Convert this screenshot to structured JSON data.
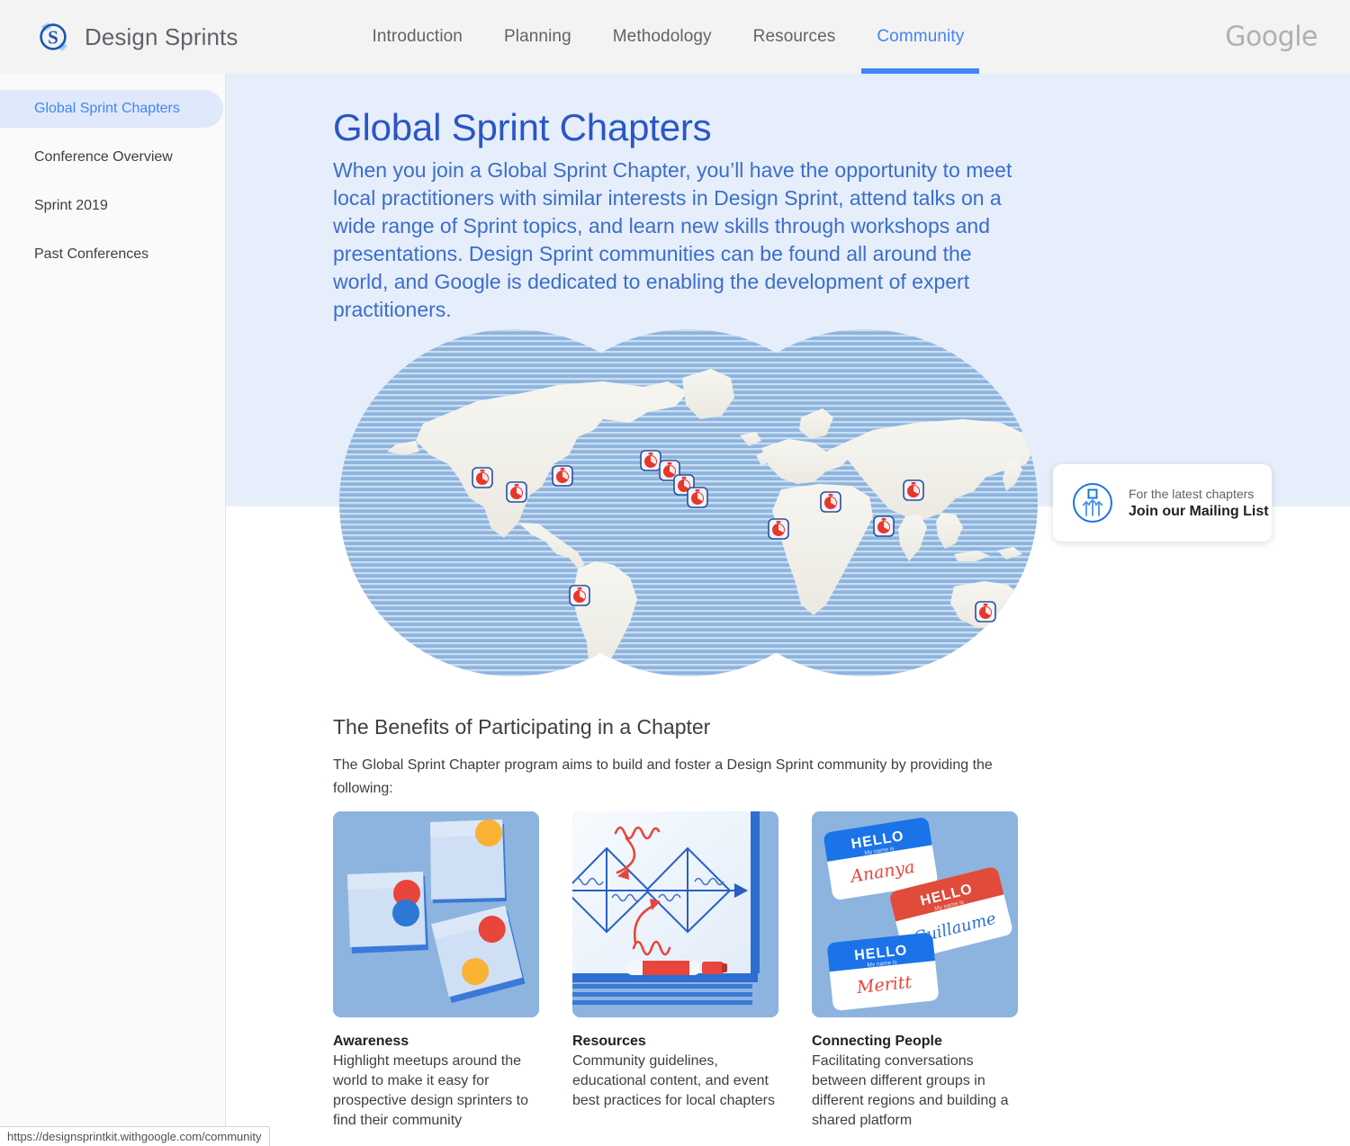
{
  "header": {
    "brand_name": "Design Sprints",
    "brand_logo_icon": "design-sprints-s-logo",
    "google_logo": "Google",
    "nav": [
      {
        "label": "Introduction",
        "active": false
      },
      {
        "label": "Planning",
        "active": false
      },
      {
        "label": "Methodology",
        "active": false
      },
      {
        "label": "Resources",
        "active": false
      },
      {
        "label": "Community",
        "active": true
      }
    ]
  },
  "sidebar": {
    "items": [
      {
        "label": "Global Sprint Chapters",
        "active": true
      },
      {
        "label": "Conference Overview",
        "active": false
      },
      {
        "label": "Sprint 2019",
        "active": false
      },
      {
        "label": "Past Conferences",
        "active": false
      }
    ]
  },
  "hero": {
    "title": "Global Sprint Chapters",
    "paragraph": "When you join a Global Sprint Chapter, you’ll have the opportunity to meet local practitioners with similar interests in Design Sprint, attend talks on a wide range of Sprint topics, and learn new skills through workshops and presentations. Design Sprint communities can be found all around the world, and Google is dedicated to enabling the development of expert practitioners."
  },
  "map": {
    "alt": "World map of global sprint chapters",
    "marker_icon": "stopwatch-pin-marker",
    "marker_count": 13
  },
  "mailing_card": {
    "icon": "mailing-list-upload-icon",
    "subtitle": "For the latest chapters",
    "title": "Join our Mailing List"
  },
  "benefits": {
    "title": "The Benefits of Participating in a Chapter",
    "subtitle": "The Global Sprint Chapter program aims to build and foster a Design Sprint community by providing the following:",
    "cards": [
      {
        "art": "sticky-notes-dot-voting-illustration",
        "heading": "Awareness",
        "body": "Highlight meetups around the world to make it easy for prospective design sprinters to find their community"
      },
      {
        "art": "whiteboard-diagram-marker-illustration",
        "heading": "Resources",
        "body": "Community guidelines, educational content, and event best practices for local chapters"
      },
      {
        "art": "hello-name-badges-illustration",
        "heading": "Connecting People",
        "body": "Facilitating conversations between different groups in different regions and building a shared platform",
        "badges": [
          {
            "greeting": "HELLO",
            "sub": "My name is",
            "name": "Ananya",
            "color": "#1a73e8"
          },
          {
            "greeting": "HELLO",
            "sub": "My name is",
            "name": "Guillaume",
            "color": "#e04b3c"
          },
          {
            "greeting": "HELLO",
            "sub": "My name is",
            "name": "Meritt",
            "color": "#1a73e8"
          }
        ]
      }
    ]
  },
  "status_bar": {
    "url": "https://designsprintkit.withgoogle.com/community"
  },
  "colors": {
    "accent_blue": "#4285f4",
    "hero_bg": "#e6eefb",
    "hero_title": "#2a56c6",
    "hero_text": "#3b6ecb",
    "nav_bg": "#f3f3f3",
    "sidebar_bg": "#fafafa",
    "sidebar_active_bg": "#dfe9fb",
    "map_ocean": "#8cb4de",
    "map_land": "#f0efe9",
    "marker_red": "#e8362a",
    "card_bg": "#8cb4de",
    "google_grey": "#b0b0b0"
  }
}
